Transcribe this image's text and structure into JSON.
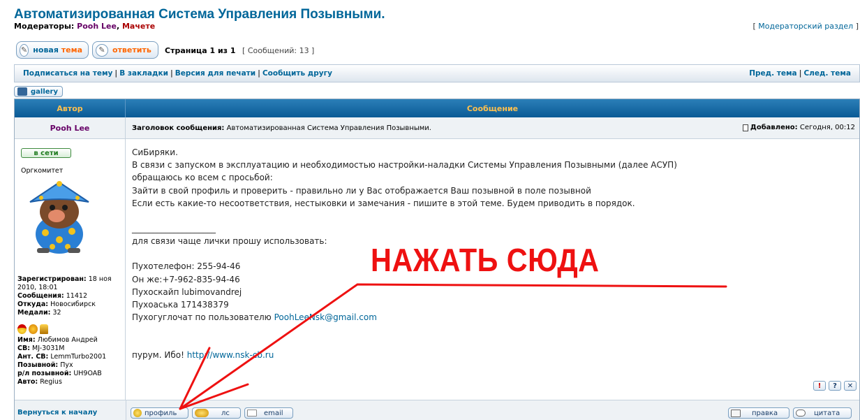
{
  "header": {
    "title": "Автоматизированная Система Управления Позывными.",
    "moderators_label": "Модераторы:",
    "moderator1": "Pooh Lee",
    "moderator2": "Мачете",
    "mod_section_open": "[",
    "mod_section_label": "Модераторский раздел",
    "mod_section_close": "]"
  },
  "actions": {
    "new_topic_part1": "новая",
    "new_topic_part2": "тема",
    "reply": "ответить",
    "page_label": "Страница 1 из 1",
    "messages_count": "[ Сообщений: 13 ]"
  },
  "navbar": {
    "left": [
      "Подписаться на тему",
      "В закладки",
      "Версия для печати",
      "Сообщить другу"
    ],
    "right": [
      "Пред. тема",
      "След. тема"
    ]
  },
  "gallery_label": "gallery",
  "table": {
    "col_author": "Автор",
    "col_message": "Сообщение"
  },
  "post": {
    "author": "Pooh Lee",
    "subject_label": "Заголовок сообщения:",
    "subject": "Автоматизированная Система Управления Позывными.",
    "added_label": "Добавлено:",
    "added_value": "Сегодня, 00:12",
    "online": "в сети",
    "rank": "Оргкомитет",
    "profile": {
      "registered_label": "Зарегистрирован:",
      "registered_value": "18 ноя",
      "registered_value2": "2010, 18:01",
      "messages_label": "Сообщения:",
      "messages_value": "11412",
      "from_label": "Откуда:",
      "from_value": "Новосибирск",
      "medals_label": "Медали:",
      "medals_value": "32",
      "name_label": "Имя:",
      "name_value": "Любимов Андрей",
      "cb_label": "СВ:",
      "cb_value": "MJ-3031M",
      "ant_label": "Ант. СВ:",
      "ant_value": "LemmTurbo2001",
      "callsign_label": "Позывной:",
      "callsign_value": "Пух",
      "radio_label": "р/л позывной:",
      "radio_value": "UH9OAB",
      "auto_label": "Авто:",
      "auto_value": "Regius"
    },
    "body": {
      "l1": "СиБиряки.",
      "l2": "В связи с запуском в эксплуатацию и необходимостью настройки-наладки Системы Управления Позывными (далее АСУП)",
      "l3": "обращаюсь ко всем с просьбой:",
      "l4": "Зайти в свой профиль и проверить - правильно ли у Вас отображается Ваш позывной в поле позывной",
      "l5": "Если есть какие-то несоответствия, нестыковки и замечания - пишите в этой теме. Будем приводить в порядок.",
      "sig_line": "____________________",
      "sig1": "для связи чаще лички прошу использовать:",
      "sig2": "Пухотелефон: 255-94-46",
      "sig3": "Он же:+7-962-835-94-46",
      "sig4": "Пухоскайп lubimovandrej",
      "sig5": "Пухоаська 171438379",
      "sig6_prefix": "Пухогуглочат по пользователю",
      "sig6_mail": "PoohLeeNsk@gmail.com",
      "sig7_prefix": "пурум. Ибо!",
      "sig7_link": "http://www.nsk-cb.ru"
    },
    "tools": {
      "report": "!",
      "info": "?",
      "delete": "✕"
    }
  },
  "footer": {
    "back_to_top": "Вернуться к началу",
    "profile_btn": "профиль",
    "pm_btn": "лс",
    "email_btn": "email",
    "edit_btn": "правка",
    "quote_btn": "цитата"
  },
  "annotation": {
    "text": "НАЖАТЬ СЮДА",
    "color": "#ee1111"
  }
}
